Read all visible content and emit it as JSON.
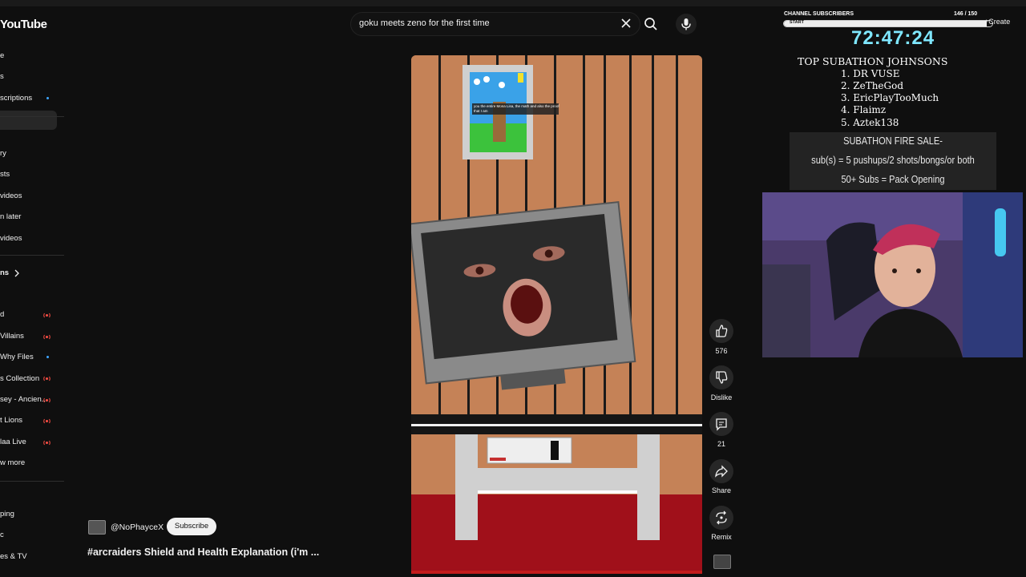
{
  "header": {
    "logo": "YouTube",
    "search_value": "goku meets zeno for the first time",
    "create_label": "Create"
  },
  "sidebar": {
    "items": [
      {
        "label": "e"
      },
      {
        "label": "s"
      },
      {
        "label": "scriptions"
      },
      {
        "label": "ry"
      },
      {
        "label": "sts"
      },
      {
        "label": "videos"
      },
      {
        "label": "n later"
      },
      {
        "label": "videos"
      },
      {
        "label": "ns"
      },
      {
        "label": "d"
      },
      {
        "label": "Villains"
      },
      {
        "label": "Why Files"
      },
      {
        "label": "s Collection"
      },
      {
        "label": "sey - Ancien..."
      },
      {
        "label": "t Lions"
      },
      {
        "label": "laa Live"
      },
      {
        "label": "w more"
      },
      {
        "label": "ping"
      },
      {
        "label": "c"
      },
      {
        "label": "es & TV"
      }
    ]
  },
  "short": {
    "caption_text": "you the entire Mona Lisa, the math and also the proof that I am",
    "channel": "@NoPhayceX",
    "subscribe_label": "Subscribe",
    "title": "#arcraiders Shield and Health Explanation (i'm ..."
  },
  "actions": {
    "like_count": "576",
    "dislike_label": "Dislike",
    "comment_count": "21",
    "share_label": "Share",
    "remix_label": "Remix"
  },
  "overlay": {
    "subgoal_label": "CHANNEL SUBSCRIBERS",
    "subgoal_count": "146 / 150",
    "subgoal_progress": 0.973,
    "subgoal_start": "START",
    "timer": "72:47:24",
    "top_title": "TOP SUBATHON JOHNSONS",
    "top_list": [
      "1.  DR VUSE",
      "2.  ZeTheGod",
      "3.  EricPlayTooMuch",
      "4.  Flaimz",
      "5.  Aztek138"
    ],
    "sale_lines": [
      "SUBATHON FIRE SALE-",
      "sub(s) = 5 pushups/2 shots/bongs/or both",
      "50+ Subs = Pack Opening"
    ]
  },
  "colors": {
    "accent_timer": "#7fe7ff",
    "live_red": "#ff4e45",
    "dot_blue": "#3ea6ff",
    "stripe_orange": "#c58257",
    "floor_red": "#a0101a"
  }
}
